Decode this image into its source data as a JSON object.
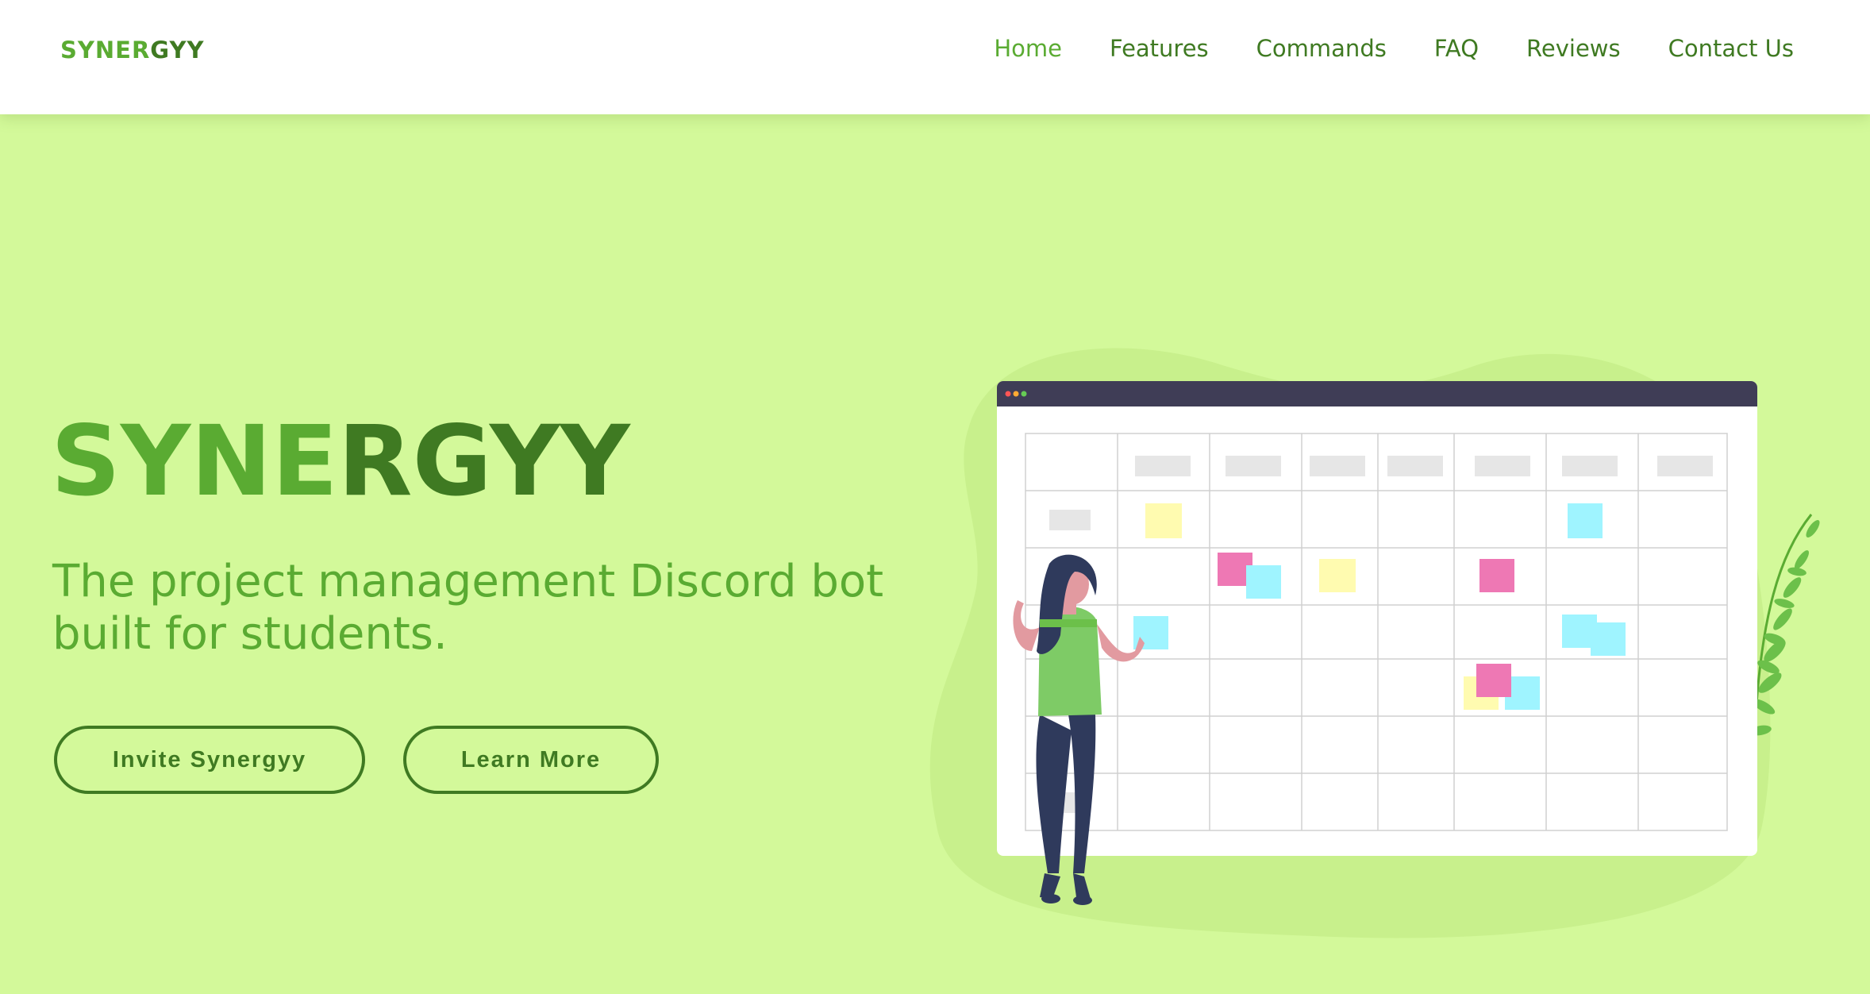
{
  "logo": {
    "part1": "SYNER",
    "part2": "GYY"
  },
  "nav": {
    "items": [
      {
        "label": "Home",
        "active": true
      },
      {
        "label": "Features",
        "active": false
      },
      {
        "label": "Commands",
        "active": false
      },
      {
        "label": "FAQ",
        "active": false
      },
      {
        "label": "Reviews",
        "active": false
      },
      {
        "label": "Contact Us",
        "active": false
      }
    ]
  },
  "hero": {
    "title_part1": "SYNE",
    "title_part2": "RGYY",
    "subtitle": "The project management Discord bot built for students.",
    "buttons": {
      "invite": "Invite Synergyy",
      "learn": "Learn More"
    }
  },
  "colors": {
    "background": "#d3f99a",
    "brand_light": "#5aab32",
    "brand_dark": "#3f7a22"
  }
}
